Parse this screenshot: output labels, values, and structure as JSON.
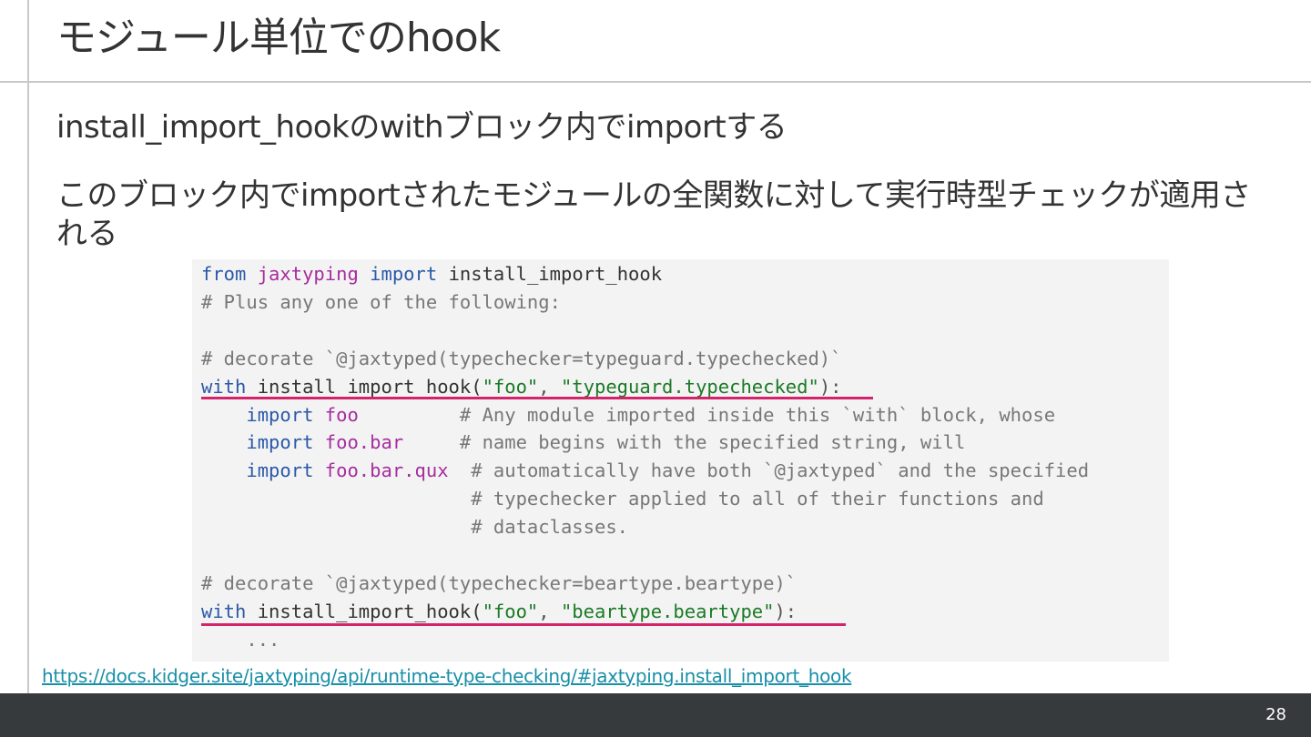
{
  "slide": {
    "title": "モジュール単位でのhook",
    "paragraph1": "install_import_hookのwithブロック内でimportする",
    "paragraph2": "このブロック内でimportされたモジュールの全関数に対して実行時型チェックが適用される",
    "link": "https://docs.kidger.site/jaxtyping/api/runtime-type-checking/#jaxtyping.install_import_hook",
    "page_number": "28"
  },
  "code": {
    "l1_from": "from",
    "l1_module": "jaxtyping",
    "l1_import": "import",
    "l1_name": "install_import_hook",
    "l2_comment": "# Plus any one of the following:",
    "l4_comment": "# decorate `@jaxtyped(typechecker=typeguard.typechecked)`",
    "l5_with": "with",
    "l5_call": "install_import_hook(",
    "l5_str1": "\"foo\"",
    "l5_sep": ", ",
    "l5_str2": "\"typeguard.typechecked\"",
    "l5_end": "):",
    "l6_import": "import",
    "l6_mod": "foo",
    "l6_comment": "# Any module imported inside this `with` block, whose",
    "l7_import": "import",
    "l7_mod": "foo.bar",
    "l7_comment": "# name begins with the specified string, will",
    "l8_import": "import",
    "l8_mod": "foo.bar.qux",
    "l8_comment": "# automatically have both `@jaxtyped` and the specified",
    "l9_comment": "# typechecker applied to all of their functions and",
    "l10_comment": "# dataclasses.",
    "l12_comment": "# decorate `@jaxtyped(typechecker=beartype.beartype)`",
    "l13_with": "with",
    "l13_call": "install_import_hook(",
    "l13_str1": "\"foo\"",
    "l13_sep": ", ",
    "l13_str2": "\"beartype.beartype\"",
    "l13_end": "):",
    "l14_ellipsis": "..."
  },
  "colors": {
    "keyword": "#2b59a8",
    "module": "#a62d9e",
    "string": "#1a7a25",
    "underline": "#d3246b",
    "link": "#1a8fa8",
    "footer": "#363a3d"
  }
}
